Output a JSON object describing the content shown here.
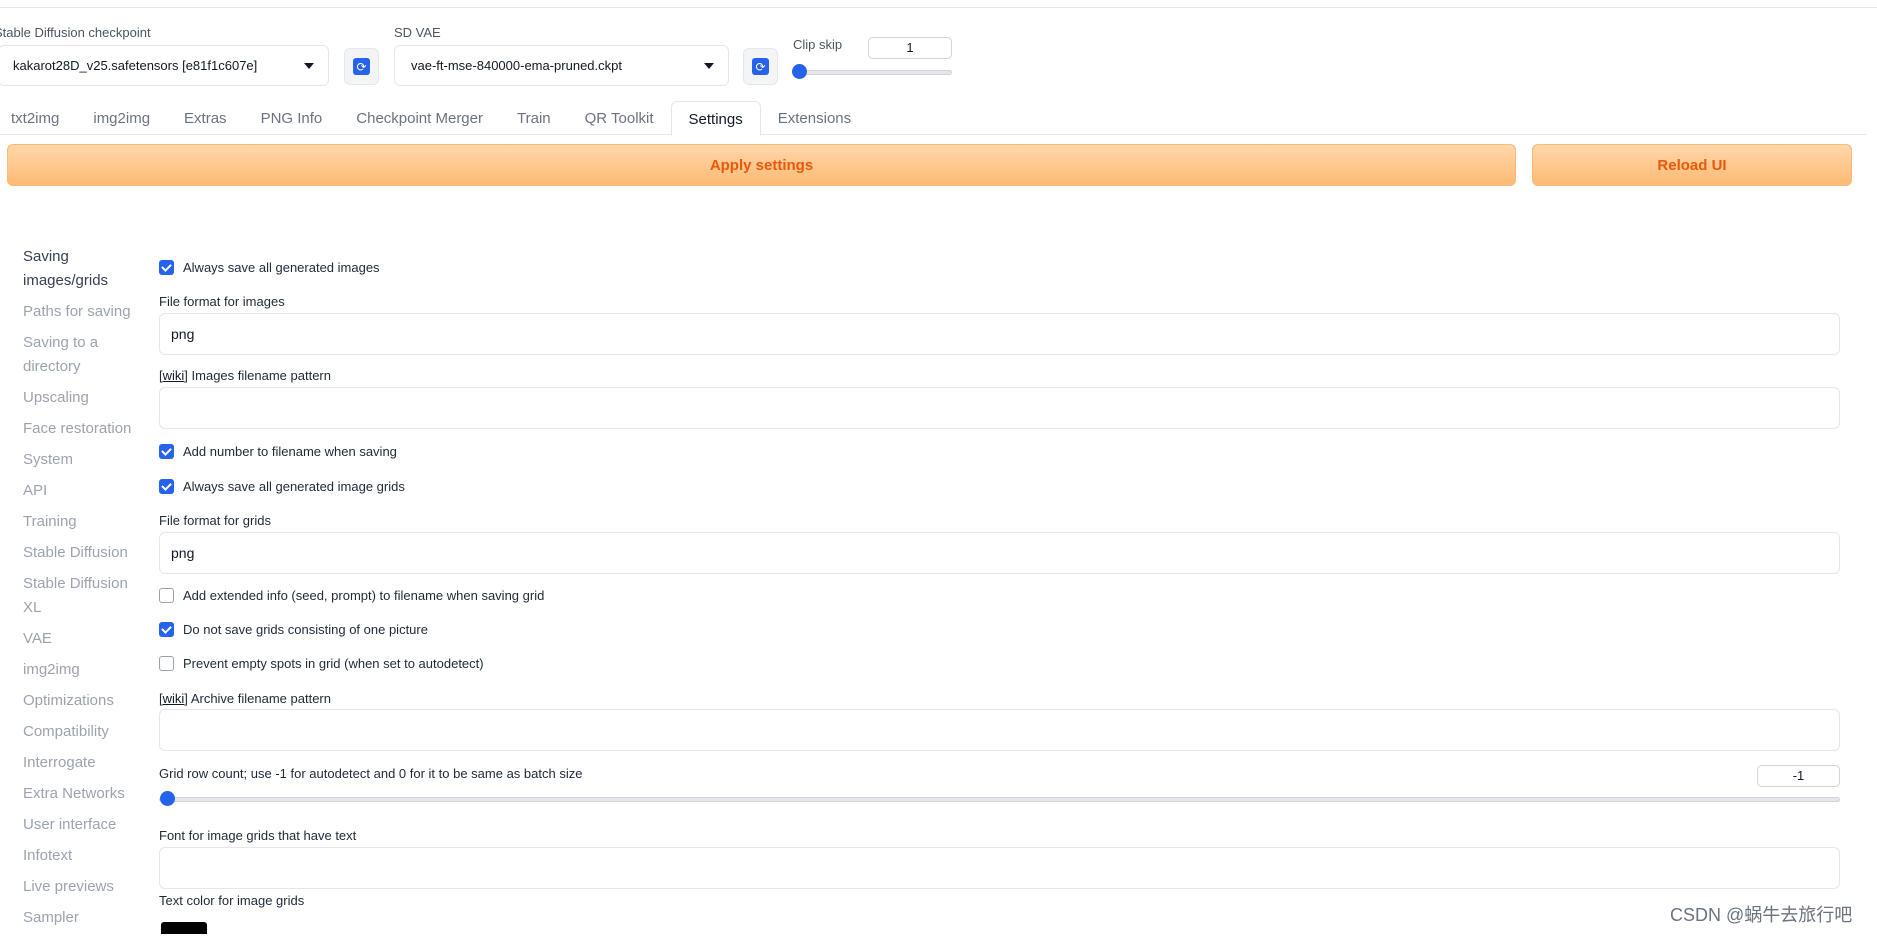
{
  "header": {
    "checkpoint_label": "Stable Diffusion checkpoint",
    "checkpoint_value": "kakarot28D_v25.safetensors [e81f1c607e]",
    "vae_label": "SD VAE",
    "vae_value": "vae-ft-mse-840000-ema-pruned.ckpt",
    "clip_skip_label": "Clip skip",
    "clip_skip_value": "1",
    "refresh_glyph": "⟳"
  },
  "tabs": [
    "txt2img",
    "img2img",
    "Extras",
    "PNG Info",
    "Checkpoint Merger",
    "Train",
    "QR Toolkit",
    "Settings",
    "Extensions"
  ],
  "actions": {
    "apply": "Apply settings",
    "reload": "Reload UI"
  },
  "sidebar": [
    "Saving images/grids",
    "Paths for saving",
    "Saving to a directory",
    "Upscaling",
    "Face restoration",
    "System",
    "API",
    "Training",
    "Stable Diffusion",
    "Stable Diffusion XL",
    "VAE",
    "img2img",
    "Optimizations",
    "Compatibility",
    "Interrogate",
    "Extra Networks",
    "User interface",
    "Infotext",
    "Live previews",
    "Sampler"
  ],
  "settings": {
    "always_save_images": "Always save all generated images",
    "file_format_images_label": "File format for images",
    "file_format_images_value": "png",
    "wiki": "wiki",
    "images_filename_pattern_label": "Images filename pattern",
    "images_filename_pattern_value": "",
    "add_number": "Add number to filename when saving",
    "always_save_grids": "Always save all generated image grids",
    "file_format_grids_label": "File format for grids",
    "file_format_grids_value": "png",
    "add_extended_info": "Add extended info (seed, prompt) to filename when saving grid",
    "no_single_grid": "Do not save grids consisting of one picture",
    "prevent_empty_spots": "Prevent empty spots in grid (when set to autodetect)",
    "archive_pattern_label": "Archive filename pattern",
    "archive_pattern_value": "",
    "grid_row_count_label": "Grid row count; use -1 for autodetect and 0 for it to be same as batch size",
    "grid_row_count_value": "-1",
    "font_label": "Font for image grids that have text",
    "font_value": "",
    "text_color_label": "Text color for image grids"
  },
  "checks": {
    "always_save_images": true,
    "add_number": true,
    "always_save_grids": true,
    "add_extended_info": false,
    "no_single_grid": true,
    "prevent_empty_spots": false
  },
  "colors": {
    "accent": "#2563eb",
    "button_orange": "#ea580c",
    "text_color_swatch": "#000000"
  },
  "watermark": "CSDN @蜗牛去旅行吧"
}
